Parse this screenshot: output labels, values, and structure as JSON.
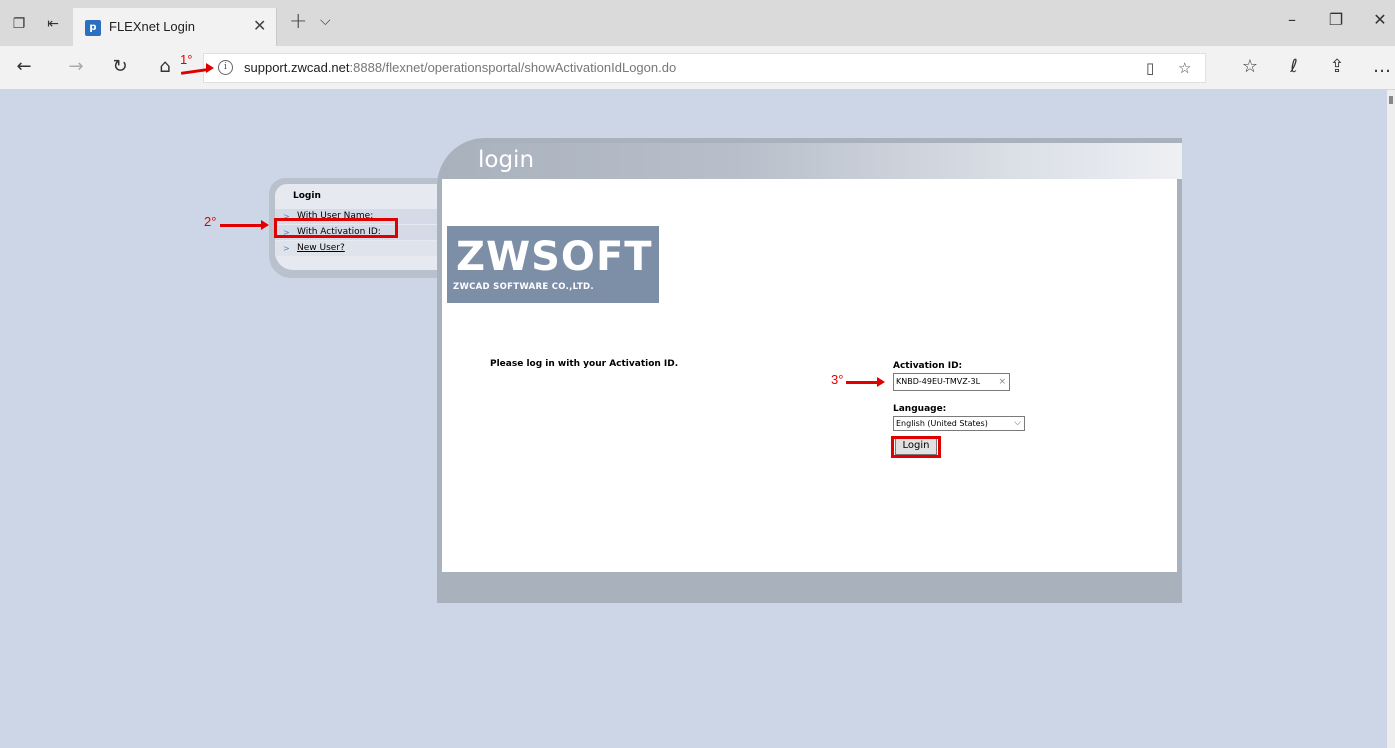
{
  "tab": {
    "title": "FLEXnet Login"
  },
  "address": {
    "host": "support.zwcad.net",
    "path": ":8888/flexnet/operationsportal/showActivationIdLogon.do"
  },
  "side_panel": {
    "title": "Login",
    "links": [
      "With User Name:",
      "With Activation ID:",
      "New User?"
    ]
  },
  "main": {
    "title": "login",
    "logo_main": "ZWSOFT",
    "logo_sub": "ZWCAD SOFTWARE CO.,LTD.",
    "prompt": "Please log in with your Activation ID.",
    "activation_label": "Activation ID:",
    "activation_value": "KNBD-49EU-TMVZ-3L",
    "language_label": "Language:",
    "language_value": "English (United States)",
    "login_button": "Login"
  },
  "annotations": {
    "step1": "1°",
    "step2": "2°",
    "step3": "3°"
  }
}
